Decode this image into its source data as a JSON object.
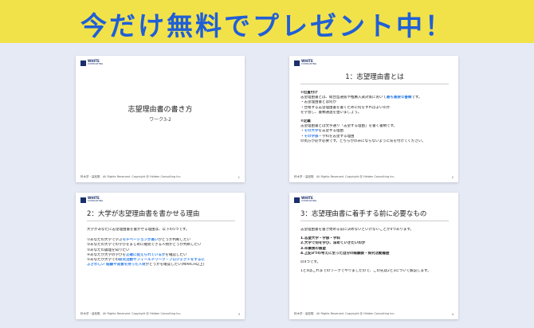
{
  "banner": {
    "title": "今だけ無料でプレゼント中！"
  },
  "logo": {
    "name": "WHITE",
    "sub": "CONSULTING"
  },
  "slides": {
    "s1": {
      "title": "志望理由書の書き方",
      "subtitle": "ワーク3-2",
      "footer": "鈴木学・高松聡　All Rights Reserved. Copyright @ Hidden Consulting Inc.",
      "page": "1"
    },
    "s2": {
      "title": "1：志望理由書とは",
      "h1": "①位置付け",
      "l1a": "志望理由書とは、総合型選抜や推薦入試対策において",
      "l1b": "最も重要な書類",
      "l1c": "です。",
      "l2": "・志望理由書とは何か",
      "l3": "・合格する志望理由書を書くために何をすればよいのか",
      "l4": "を学習し、書類通過を狙いましょう。",
      "h2": "②定義",
      "l5": "志望理由書とは文字通り「志望する理由」を書く書類です。",
      "l6a": "・",
      "l6b": "その大学",
      "l6c": "を志望する理由",
      "l7a": "・",
      "l7b": "その学部",
      "l7c": "・学科を志望する理由",
      "l8": "の両方が必ず必要です。どちらかのみにならないように気を付けてください。",
      "footer": "鈴木学・高松聡　All Rights Reserved. Copyright @ Hidden Consulting Inc.",
      "page": "2"
    },
    "s3": {
      "title": "2：大学が志望理由書を書かせる理由",
      "intro": "大学があなたに志望理由書を書かせる理由は、以下の5つです。",
      "i1a": "①あなたの大学で学ぶ",
      "i1b": "モチベーションが高い",
      "i1c": "かどうか判断したい",
      "i2": "②あなたの大学での学びをまじめに継続できる人物かどうか判断したい",
      "i3": "③あなたの論理を知りたい",
      "i4a": "④あなたが大学の学びを",
      "i4b": "正確に捉えられているか",
      "i4c": "を確認したい",
      "i5a": "⑤あなたが大学での",
      "i5b": "研究活動やフィールドワーク・プロジェクトをするに",
      "i5c": "ふさわしい 経験や背景を持った人材",
      "i5d": "かどうかを確認したい(MARCH以上)",
      "footer": "鈴木学・高松聡　All Rights Reserved. Copyright @ Hidden Consulting Inc.",
      "page": "3"
    },
    "s4": {
      "title": "3：志望理由書に着手する前に必要なもの",
      "intro": "志望理由書を書き始める前に決めないといけないことが4つあります。",
      "i1": "1.志望大学・学部・学科",
      "i2": "2.大学で何を学び、深めていきたいのか",
      "i3": "3.卒業後の展望",
      "i4": "4.上記3つの考えに至った自分の経験談・探究活動履歴",
      "outro1": "の4つです。",
      "outro2": "1と4はこれまでのワークでやりましたので、この先は2と3について解説します。",
      "footer": "鈴木学・高松聡　All Rights Reserved. Copyright @ Hidden Consulting Inc.",
      "page": "4"
    }
  }
}
